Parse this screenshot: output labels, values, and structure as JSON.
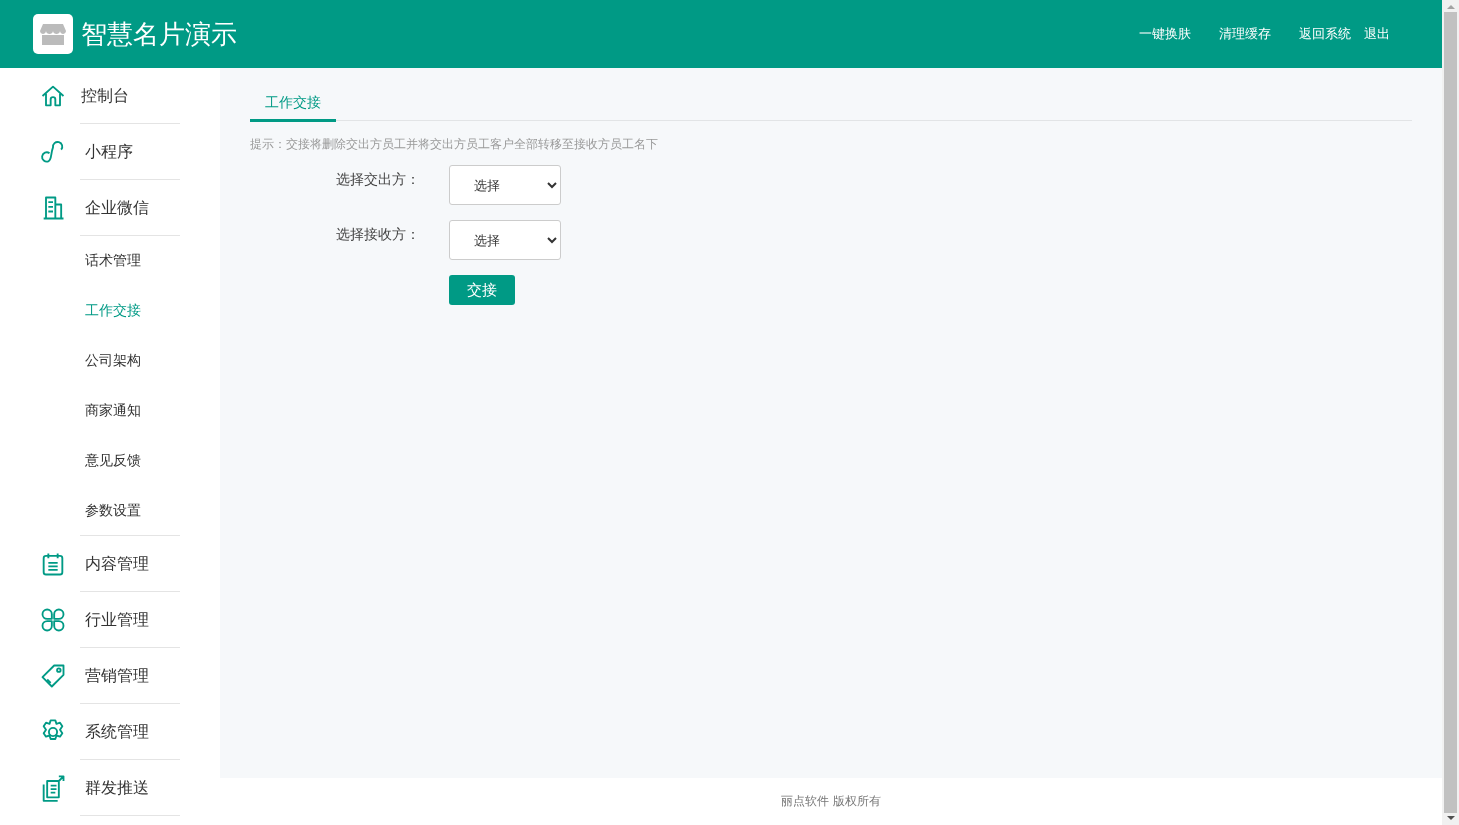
{
  "header": {
    "title": "智慧名片演示",
    "links": [
      "一键换肤",
      "清理缓存",
      "返回系统",
      "退出"
    ]
  },
  "sidebar": {
    "items": [
      {
        "kind": "main",
        "label": "控制台",
        "selected": false
      },
      {
        "kind": "main",
        "label": "小程序",
        "selected": false
      },
      {
        "kind": "main",
        "label": "企业微信",
        "selected": false
      },
      {
        "kind": "sub",
        "label": "话术管理",
        "selected": false
      },
      {
        "kind": "sub",
        "label": "工作交接",
        "selected": true
      },
      {
        "kind": "sub",
        "label": "公司架构",
        "selected": false
      },
      {
        "kind": "sub",
        "label": "商家通知",
        "selected": false
      },
      {
        "kind": "sub",
        "label": "意见反馈",
        "selected": false
      },
      {
        "kind": "sub",
        "label": "参数设置",
        "selected": false
      },
      {
        "kind": "main",
        "label": "内容管理",
        "selected": false
      },
      {
        "kind": "main",
        "label": "行业管理",
        "selected": false
      },
      {
        "kind": "main",
        "label": "营销管理",
        "selected": false
      },
      {
        "kind": "main",
        "label": "系统管理",
        "selected": false
      },
      {
        "kind": "main",
        "label": "群发推送",
        "selected": false
      }
    ]
  },
  "tabs": [
    {
      "label": "工作交接",
      "selected": true
    }
  ],
  "hint": "提示：交接将删除交出方员工并将交出方员工客户全部转移至接收方员工名下",
  "form": {
    "fields": [
      {
        "label": "选择交出方：",
        "value": "选择"
      },
      {
        "label": "选择接收方：",
        "value": "选择"
      }
    ],
    "submit": "交接"
  },
  "footer": "丽点软件 版权所有"
}
